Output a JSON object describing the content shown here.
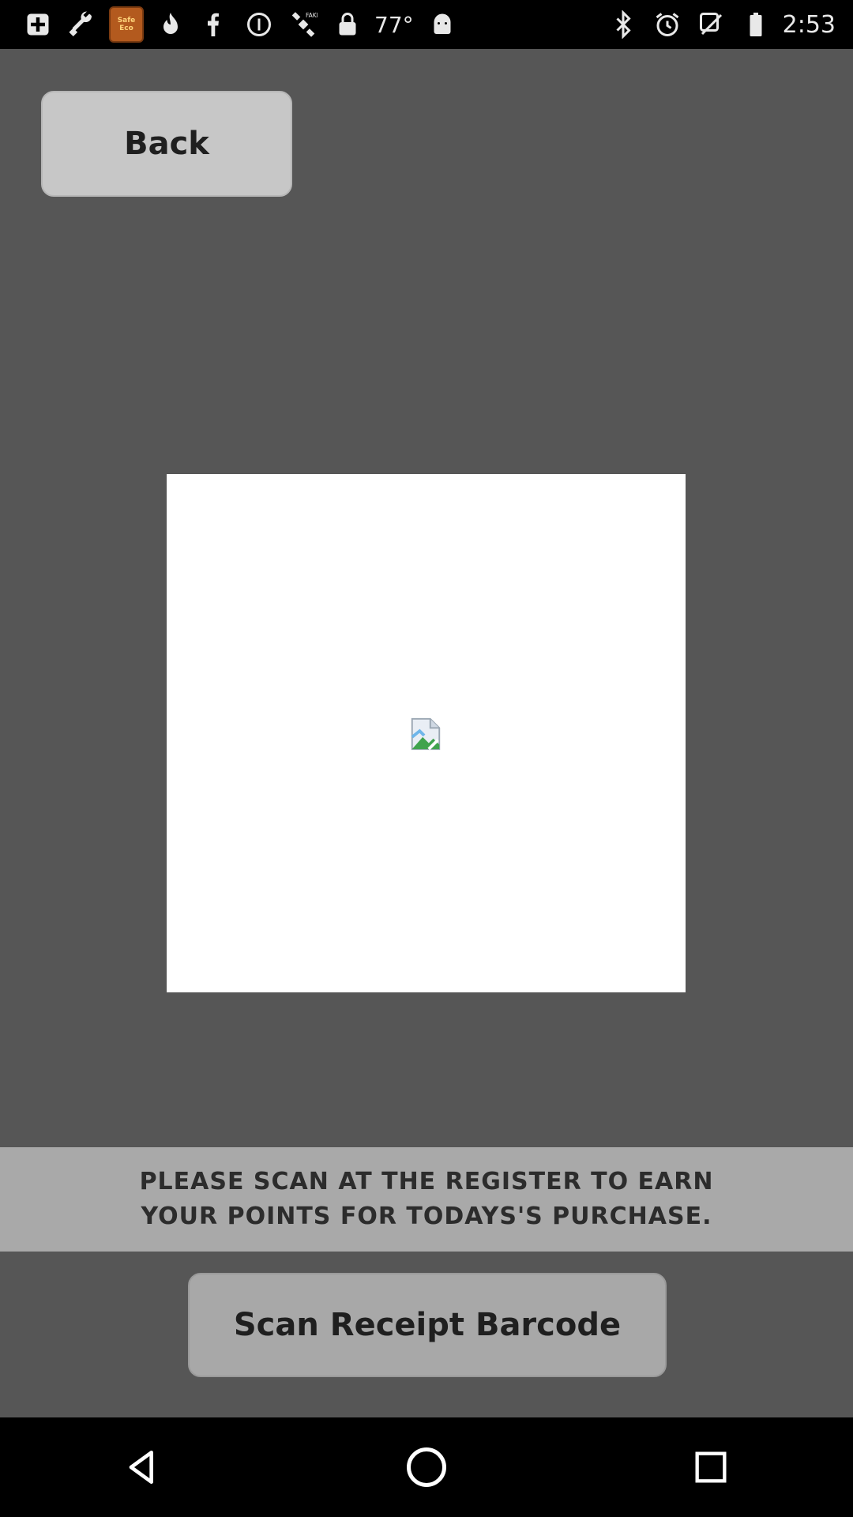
{
  "status_bar": {
    "temperature": "77°",
    "time": "2:53",
    "app_badge_text": "Safe Eco",
    "left_icons": [
      "medical-plus-icon",
      "wrench-icon",
      "app-badge-icon",
      "flame-icon",
      "facebook-icon",
      "circle-info-icon",
      "fake-gps-icon",
      "lock-icon"
    ],
    "right_icons": [
      "android-icon",
      "bluetooth-icon",
      "alarm-icon",
      "signal-off-icon",
      "battery-icon"
    ]
  },
  "header": {
    "back_label": "Back"
  },
  "main": {
    "image_state": "broken-image-icon",
    "message": "PLEASE SCAN AT THE REGISTER TO EARN YOUR POINTS FOR TODAYS'S PURCHASE.",
    "scan_button_label": "Scan Receipt Barcode"
  },
  "nav_bar": {
    "buttons": [
      "back-triangle-icon",
      "home-circle-icon",
      "recents-square-icon"
    ]
  },
  "colors": {
    "background": "#565656",
    "button": "#c7c7c7",
    "message_strip": "#a9a9a9",
    "card": "#ffffff"
  }
}
